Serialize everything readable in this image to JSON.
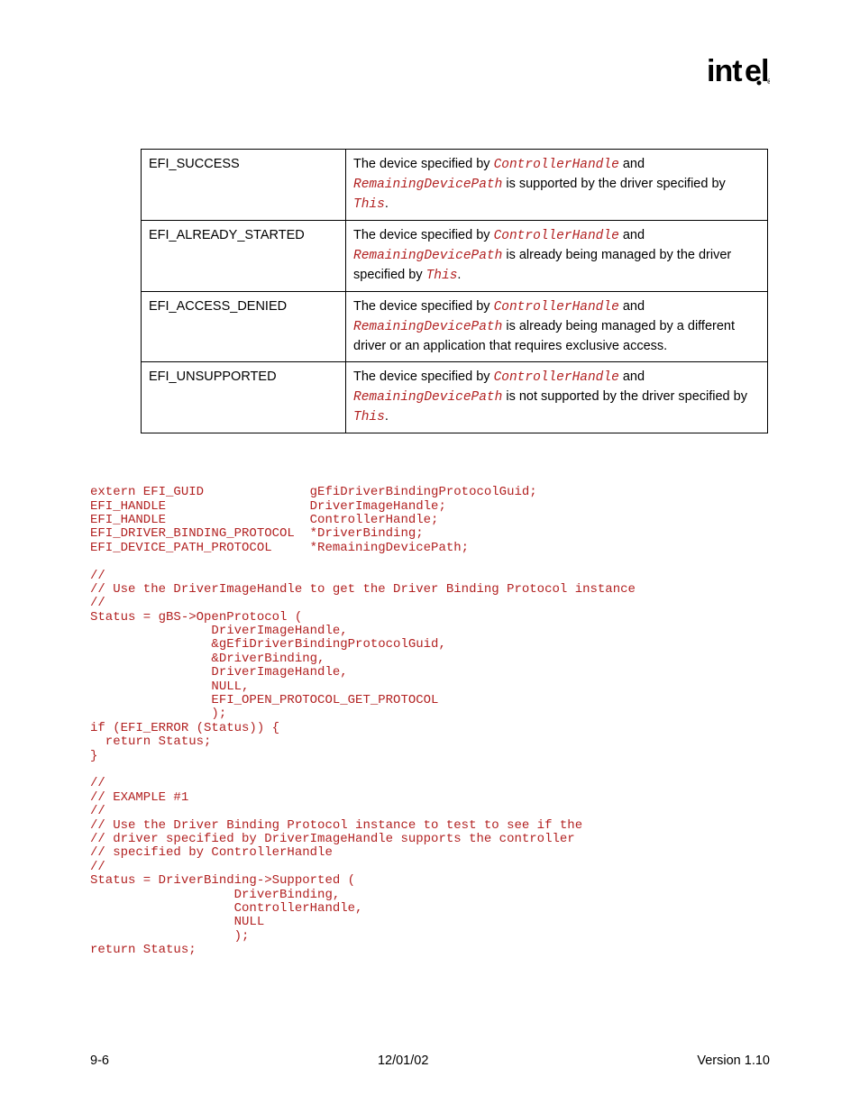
{
  "logo": "intel",
  "table": {
    "rows": [
      {
        "code": "EFI_SUCCESS",
        "desc_parts": [
          "The device specified by ",
          "ControllerHandle",
          " and ",
          "RemainingDevicePath",
          " is supported by the driver specified by ",
          "This",
          "."
        ]
      },
      {
        "code": "EFI_ALREADY_STARTED",
        "desc_parts": [
          "The device specified by ",
          "ControllerHandle",
          " and ",
          "RemainingDevicePath",
          " is already being managed by the driver specified by ",
          "This",
          "."
        ]
      },
      {
        "code": "EFI_ACCESS_DENIED",
        "desc_parts": [
          "The device specified by ",
          "ControllerHandle",
          " and ",
          "RemainingDevicePath",
          " is already being managed by a different driver or an application that requires exclusive access."
        ]
      },
      {
        "code": "EFI_UNSUPPORTED",
        "desc_parts": [
          "The device specified by ",
          "ControllerHandle",
          " and ",
          "RemainingDevicePath",
          " is not supported by the driver specified by ",
          "This",
          "."
        ]
      }
    ]
  },
  "code_block": "extern EFI_GUID              gEfiDriverBindingProtocolGuid;\nEFI_HANDLE                   DriverImageHandle;\nEFI_HANDLE                   ControllerHandle;\nEFI_DRIVER_BINDING_PROTOCOL  *DriverBinding;\nEFI_DEVICE_PATH_PROTOCOL     *RemainingDevicePath;\n\n//\n// Use the DriverImageHandle to get the Driver Binding Protocol instance\n//\nStatus = gBS->OpenProtocol (\n                DriverImageHandle,\n                &gEfiDriverBindingProtocolGuid,\n                &DriverBinding,\n                DriverImageHandle,\n                NULL,\n                EFI_OPEN_PROTOCOL_GET_PROTOCOL\n                );\nif (EFI_ERROR (Status)) {\n  return Status;\n}\n\n//\n// EXAMPLE #1\n//\n// Use the Driver Binding Protocol instance to test to see if the\n// driver specified by DriverImageHandle supports the controller\n// specified by ControllerHandle\n//\nStatus = DriverBinding->Supported (\n                   DriverBinding,\n                   ControllerHandle,\n                   NULL\n                   );\nreturn Status;",
  "footer": {
    "left": "9-6",
    "center": "12/01/02",
    "right": "Version 1.10"
  }
}
